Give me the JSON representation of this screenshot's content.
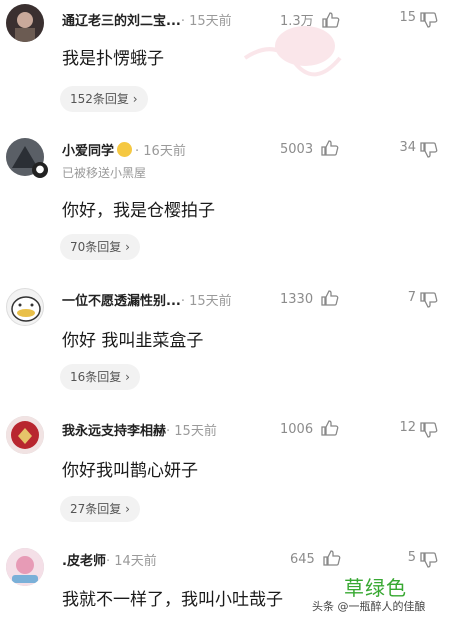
{
  "comments": [
    {
      "username": "通辽老三的刘二宝...",
      "time": "· 15天前",
      "likes": "1.3万",
      "dislikes": "15",
      "text": "我是扑愣蛾子",
      "replies": "152条回复 ›"
    },
    {
      "username": "小爱同学",
      "time": "· 16天前",
      "likes": "5003",
      "dislikes": "34",
      "note": "已被移送小黑屋",
      "text": "你好，我是仓樱拍子",
      "replies": "70条回复 ›"
    },
    {
      "username": "一位不愿透漏性别...",
      "time": "· 15天前",
      "likes": "1330",
      "dislikes": "7",
      "text": "你好 我叫韭菜盒子",
      "replies": "16条回复 ›"
    },
    {
      "username": "我永远支持李相赫",
      "time": "· 15天前",
      "likes": "1006",
      "dislikes": "12",
      "text": "你好我叫鹊心妍子",
      "replies": "27条回复 ›"
    },
    {
      "username": ".皮老师",
      "time": "· 14天前",
      "likes": "645",
      "dislikes": "5",
      "text": "我就不一样了，我叫小吐哉子"
    }
  ],
  "overlay": {
    "caption": "草绿色",
    "source": "头条 @一瓶醉人的佳酿"
  },
  "colors": {
    "caption_green": "#38a832",
    "pill_bg": "#f2f2f2"
  }
}
